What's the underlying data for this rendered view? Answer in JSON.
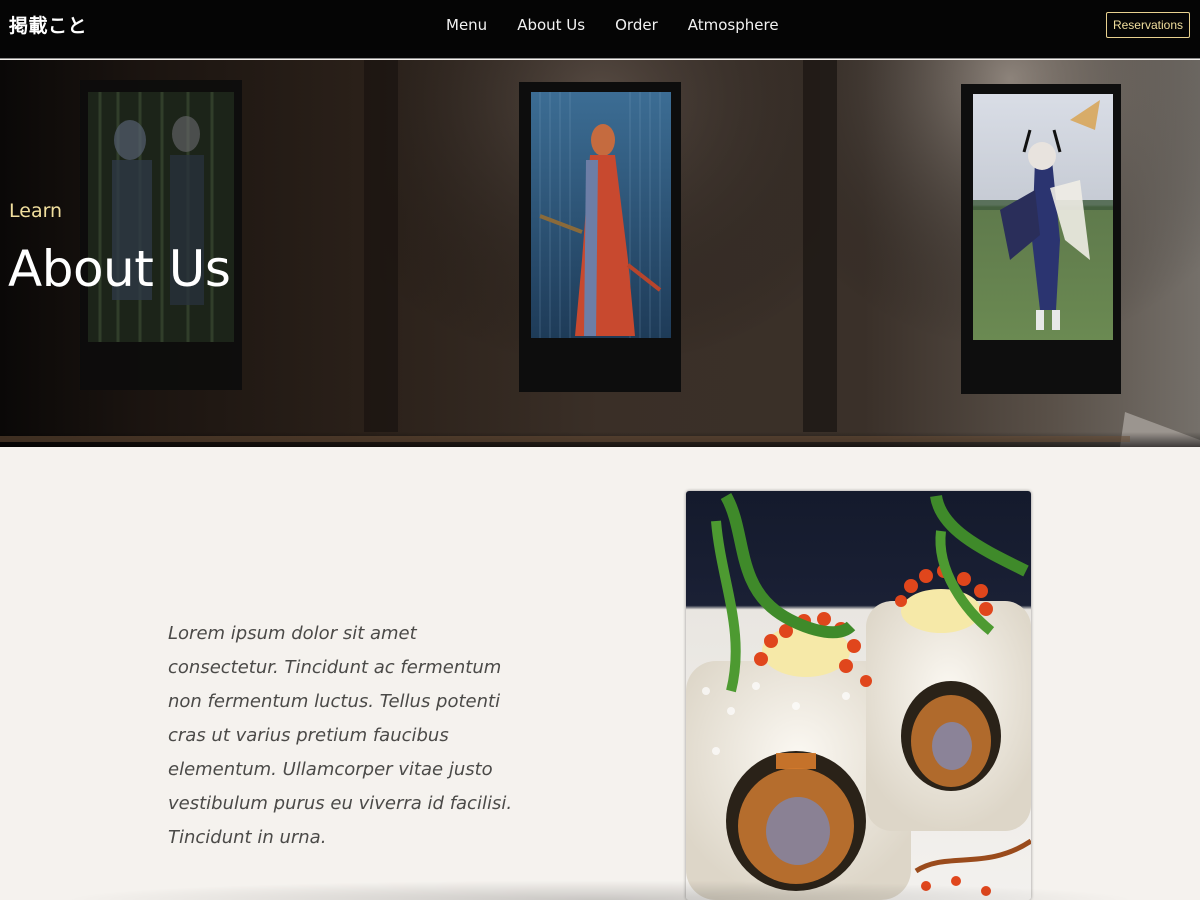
{
  "brand": "掲載こと",
  "nav": {
    "links": [
      "Menu",
      "About Us",
      "Order",
      "Atmosphere"
    ],
    "reservations_label": "Reservations"
  },
  "hero": {
    "kicker": "Learn",
    "title": "About Us"
  },
  "about": {
    "paragraph": "Lorem ipsum dolor sit amet consectetur. Tincidunt ac fermentum non fermentum luctus. Tellus potenti cras ut varius pretium faucibus elementum. Ullamcorper vitae justo vestibulum purus eu viverra id facilisi. Tincidunt in urna."
  },
  "colors": {
    "nav_background": "#050505",
    "accent_gold": "#f1df9e",
    "page_background": "#f5f2ee",
    "body_text": "#4b4a48"
  }
}
